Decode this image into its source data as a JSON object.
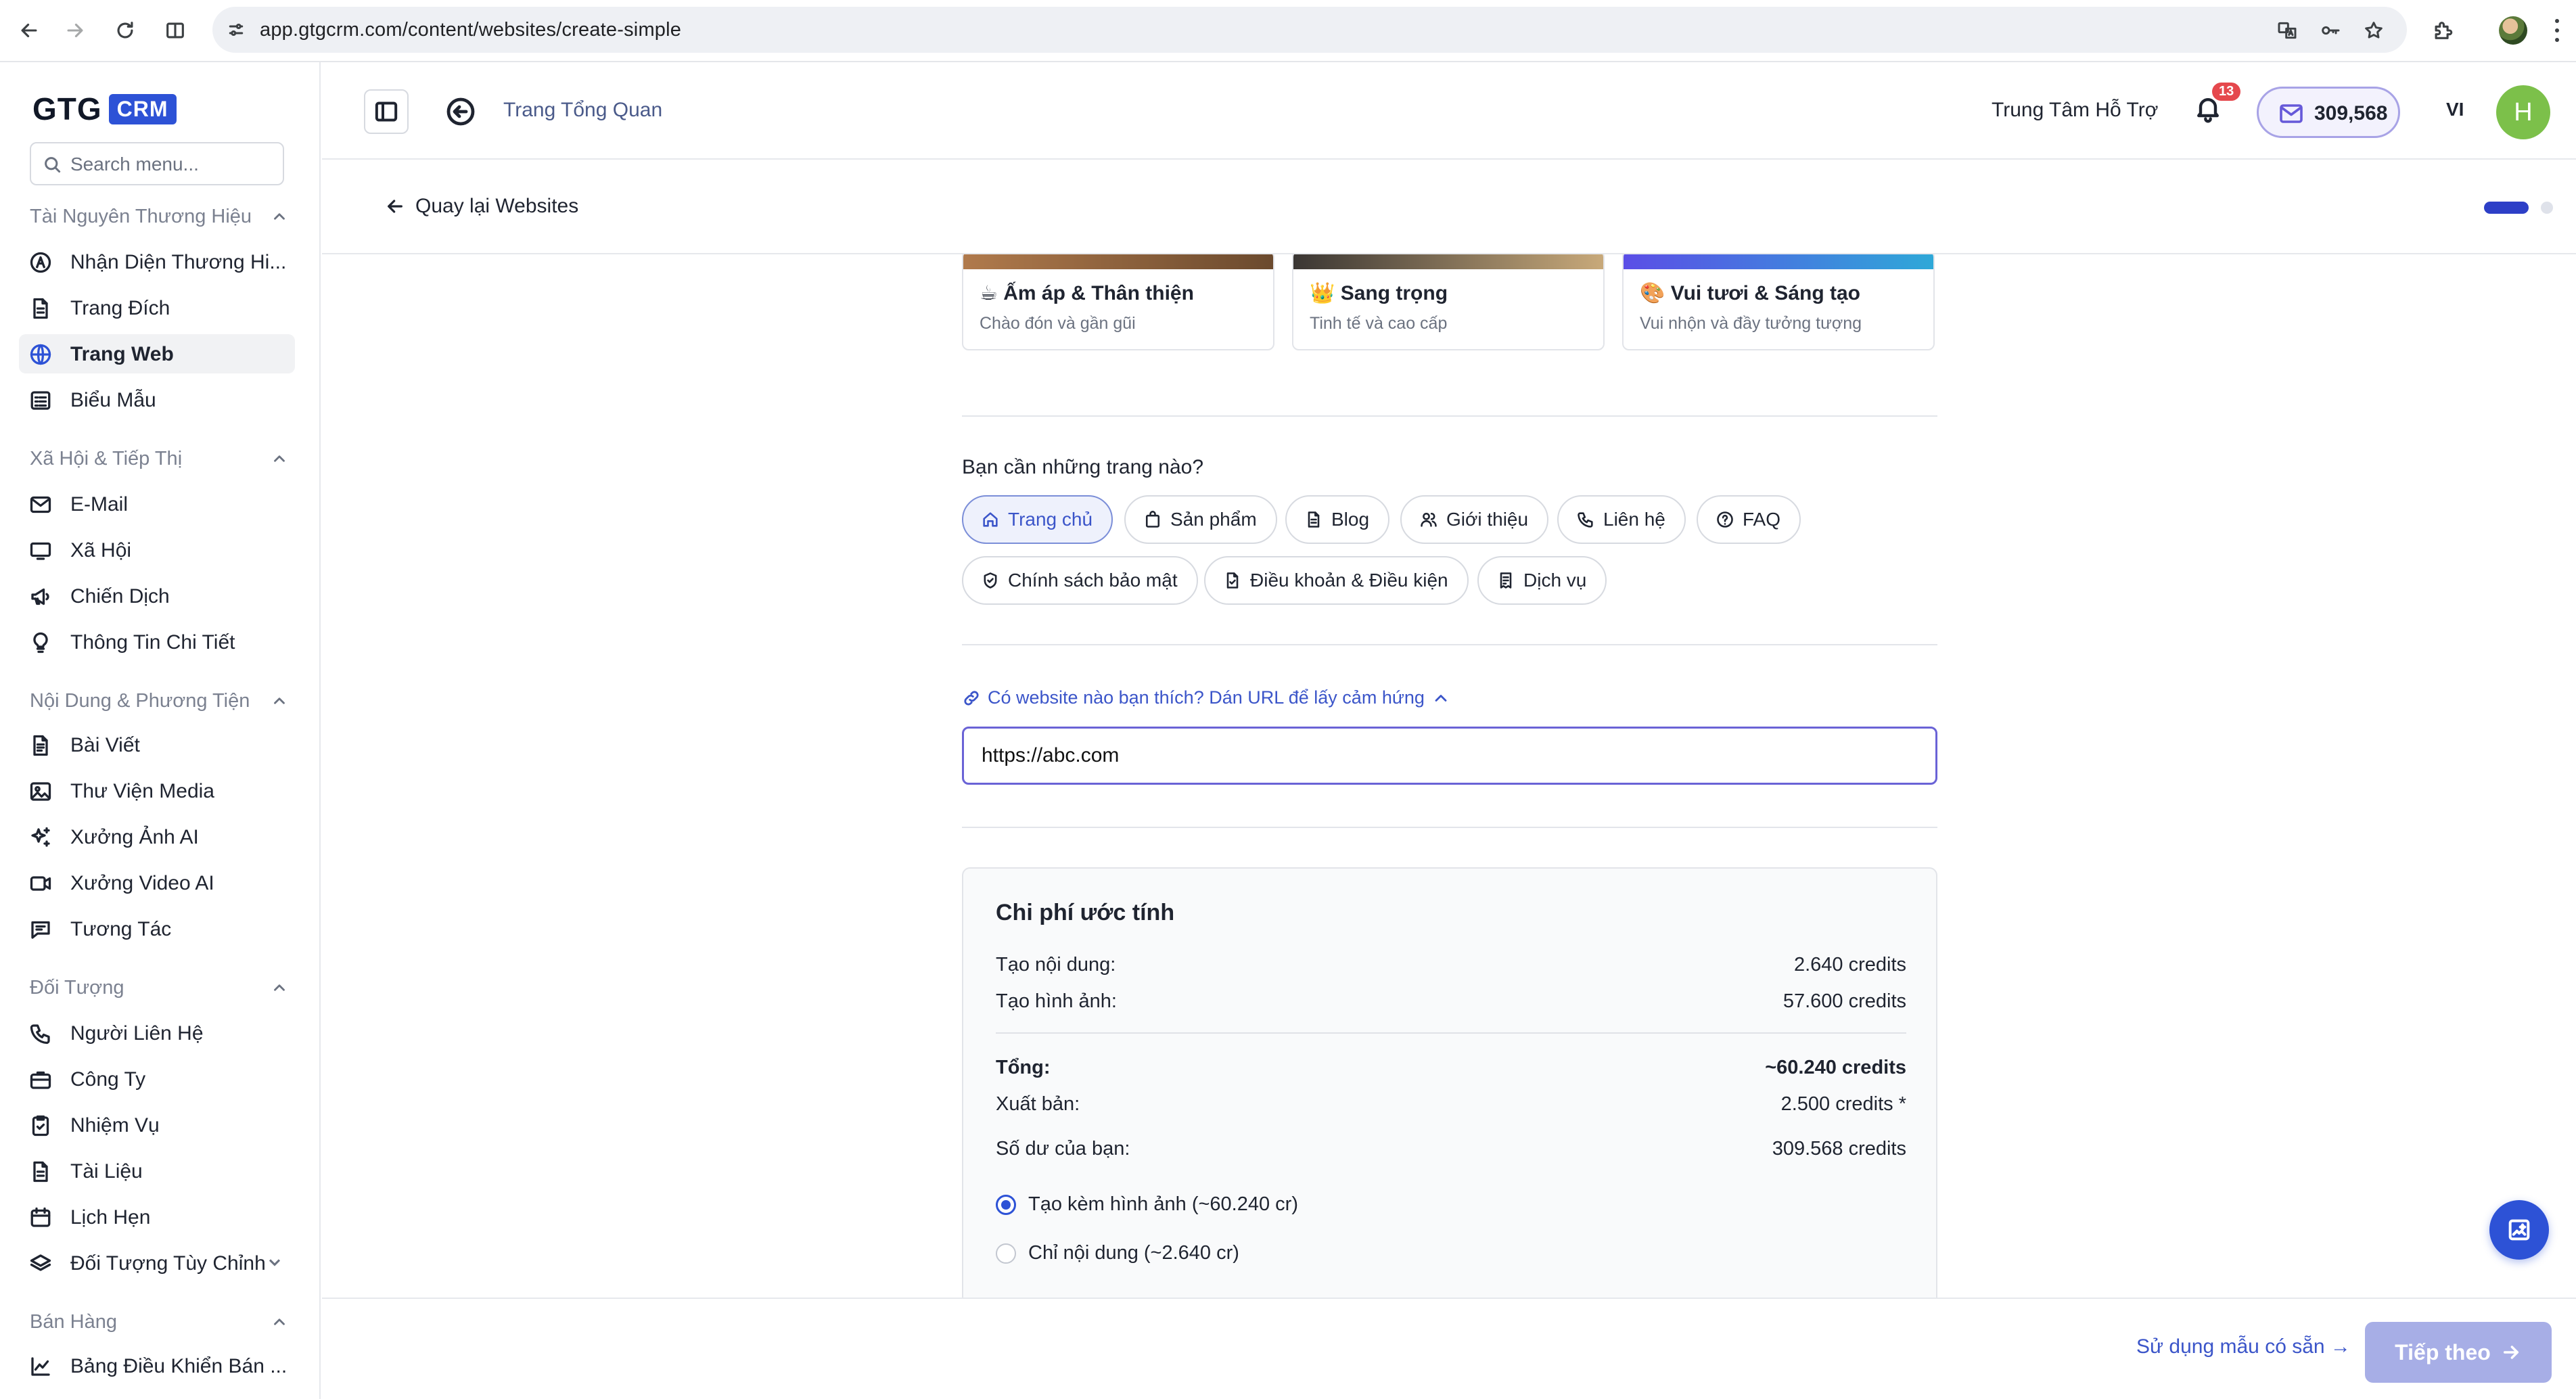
{
  "browser": {
    "url": "app.gtgcrm.com/content/websites/create-simple"
  },
  "sidebar": {
    "logo_text": "GTG",
    "logo_badge": "CRM",
    "search_placeholder": "Search menu...",
    "sections": [
      {
        "label": "Tài Nguyên Thương Hiệu",
        "items": [
          {
            "label": "Nhận Diện Thương Hi...",
            "icon": "brand-icon"
          },
          {
            "label": "Trang Đích",
            "icon": "file-icon"
          },
          {
            "label": "Trang Web",
            "icon": "globe-icon",
            "active": true
          },
          {
            "label": "Biểu Mẫu",
            "icon": "form-icon"
          }
        ]
      },
      {
        "label": "Xã Hội & Tiếp Thị",
        "items": [
          {
            "label": "E-Mail",
            "icon": "mail-icon"
          },
          {
            "label": "Xã Hội",
            "icon": "monitor-icon"
          },
          {
            "label": "Chiến Dịch",
            "icon": "megaphone-icon"
          },
          {
            "label": "Thông Tin Chi Tiết",
            "icon": "lightbulb-icon"
          }
        ]
      },
      {
        "label": "Nội Dung & Phương Tiện",
        "items": [
          {
            "label": "Bài Viết",
            "icon": "document-icon"
          },
          {
            "label": "Thư Viện Media",
            "icon": "image-icon"
          },
          {
            "label": "Xưởng Ảnh AI",
            "icon": "sparkle-icon"
          },
          {
            "label": "Xưởng Video AI",
            "icon": "video-icon"
          },
          {
            "label": "Tương Tác",
            "icon": "list-icon"
          }
        ]
      },
      {
        "label": "Đối Tượng",
        "items": [
          {
            "label": "Người Liên Hệ",
            "icon": "phone-icon"
          },
          {
            "label": "Công Ty",
            "icon": "briefcase-icon"
          },
          {
            "label": "Nhiệm Vụ",
            "icon": "clipboard-check-icon"
          },
          {
            "label": "Tài Liệu",
            "icon": "file-text-icon"
          },
          {
            "label": "Lịch Hẹn",
            "icon": "calendar-icon"
          },
          {
            "label": "Đối Tượng Tùy Chỉnh",
            "icon": "layers-icon"
          }
        ]
      },
      {
        "label": "Bán Hàng",
        "items": [
          {
            "label": "Bảng Điều Khiển Bán ...",
            "icon": "chart-line-icon"
          }
        ]
      }
    ]
  },
  "header": {
    "breadcrumb": "Trang Tổng Quan",
    "support": "Trung Tâm Hỗ Trợ",
    "notification_count": "13",
    "credits": "309,568",
    "language": "VI",
    "avatar_initial": "H"
  },
  "subheader": {
    "back_label": "Quay lại Websites"
  },
  "styles": [
    {
      "emoji": "☕",
      "title": "Ấm áp & Thân thiện",
      "desc": "Chào đón và gần gũi",
      "color_a": "#b07a4c",
      "color_b": "#6b4a2e"
    },
    {
      "emoji": "👑",
      "title": "Sang trọng",
      "desc": "Tinh tế và cao cấp",
      "color_a": "#3a3633",
      "color_b": "#c8a97a"
    },
    {
      "emoji": "🎨",
      "title": "Vui tươi & Sáng tạo",
      "desc": "Vui nhộn và đầy tưởng tượng",
      "color_a": "#5b4ee6",
      "color_b": "#2ea8d8"
    }
  ],
  "pages": {
    "question": "Bạn cần những trang nào?",
    "options": [
      {
        "label": "Trang chủ",
        "icon": "home-icon",
        "selected": true
      },
      {
        "label": "Sản phẩm",
        "icon": "bag-icon"
      },
      {
        "label": "Blog",
        "icon": "document-icon"
      },
      {
        "label": "Giới thiệu",
        "icon": "users-icon"
      },
      {
        "label": "Liên hệ",
        "icon": "phone-icon"
      },
      {
        "label": "FAQ",
        "icon": "help-circle-icon"
      },
      {
        "label": "Chính sách bảo mật",
        "icon": "shield-icon"
      },
      {
        "label": "Điều khoản & Điều kiện",
        "icon": "file-check-icon"
      },
      {
        "label": "Dịch vụ",
        "icon": "receipt-icon"
      }
    ]
  },
  "inspiration": {
    "link_label": "Có website nào bạn thích? Dán URL để lấy cảm hứng",
    "url_value": "https://abc.com"
  },
  "cost": {
    "title": "Chi phí ước tính",
    "content_label": "Tạo nội dung:",
    "content_value": "2.640 credits",
    "image_label": "Tạo hình ảnh:",
    "image_value": "57.600 credits",
    "total_label": "Tổng:",
    "total_value": "~60.240 credits",
    "publish_label": "Xuất bản:",
    "publish_value": "2.500 credits *",
    "balance_label": "Số dư của bạn:",
    "balance_value": "309.568 credits",
    "option_with_images": "Tạo kèm hình ảnh (~60.240 cr)",
    "option_content_only": "Chỉ nội dung (~2.640 cr)",
    "selected_option": "with_images"
  },
  "footer": {
    "template_link": "Sử dụng mẫu có sẵn →",
    "next_label": "Tiếp theo"
  },
  "colors": {
    "accent": "#2d52d6",
    "link": "#3b55c9",
    "next_disabled": "#a7aee6"
  }
}
